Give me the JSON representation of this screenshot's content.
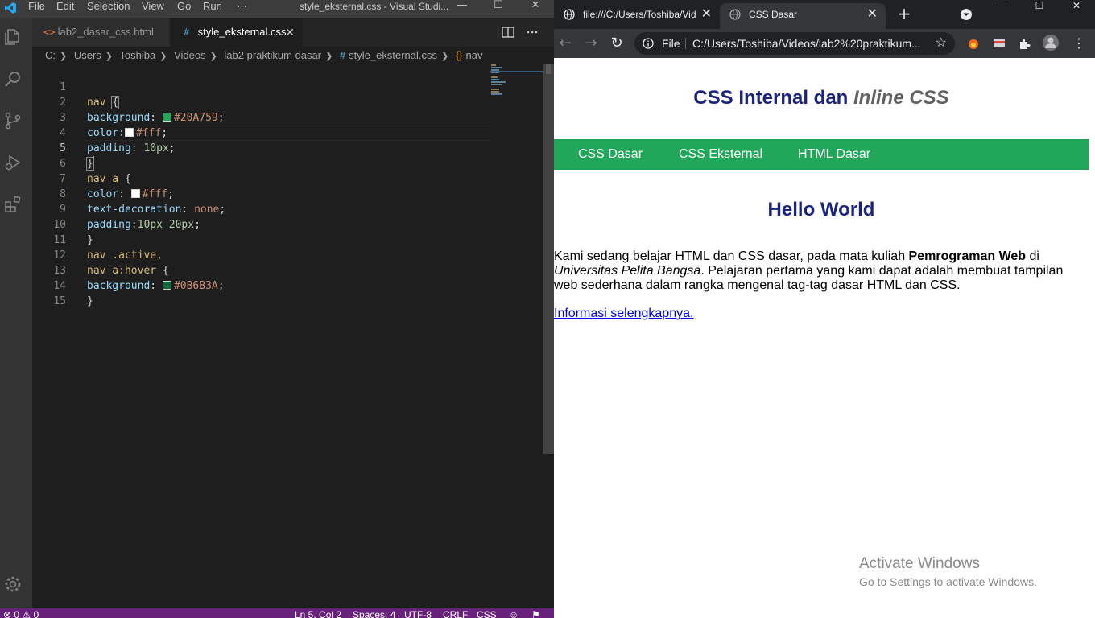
{
  "vscode": {
    "menu": [
      "File",
      "Edit",
      "Selection",
      "View",
      "Go",
      "Run",
      "···"
    ],
    "window_title": "style_eksternal.css - Visual Studi...",
    "tabs": [
      {
        "label": "lab2_dasar_css.html",
        "glyph": "<>"
      },
      {
        "label": "style_eksternal.css",
        "glyph": "#",
        "close": "✕"
      }
    ],
    "breadcrumb": [
      "C:",
      "Users",
      "Toshiba",
      "Videos",
      "lab2 praktikum dasar",
      "style_eksternal.css",
      "nav"
    ],
    "colors": {
      "nav_bg": "#20A759",
      "hover_bg": "#0B6B3A",
      "white": "#fff"
    },
    "code": {
      "line_numbers": [
        "1",
        "2",
        "3",
        "4",
        "5",
        "6",
        "7",
        "8",
        "9",
        "10",
        "11",
        "12",
        "13",
        "14",
        "15"
      ],
      "l1_sel": "nav ",
      "l1_brace": "{",
      "l2_prop": "background",
      "l2_val": "#20A759",
      "l3_prop": "color",
      "l3_val": "#fff",
      "l4_prop": "padding",
      "l4_val": "10px",
      "l5_brace": "}",
      "l6_sel": "nav a ",
      "l6_brace": "{",
      "l7_prop": "color",
      "l7_val": "#fff",
      "l8_prop": "text-decoration",
      "l8_val": "none",
      "l9_prop": "padding",
      "l9_val": "10px 20px",
      "l10_brace": "}",
      "l11_sel": "nav .active,",
      "l12_sel": "nav a:hover ",
      "l12_brace": "{",
      "l13_prop": "background",
      "l13_val": "#0B6B3A",
      "l14_brace": "}"
    },
    "status": {
      "problems": "⊗ 0 ⚠ 0",
      "position": "Ln 5, Col 2",
      "spaces": "Spaces: 4",
      "encoding": "UTF-8",
      "eol": "CRLF",
      "language": "CSS"
    }
  },
  "chrome": {
    "tabs": [
      {
        "label": "file:///C:/Users/Toshiba/Vid",
        "close": "✕"
      },
      {
        "label": "CSS Dasar",
        "close": "✕"
      }
    ],
    "new_tab": "+",
    "omnibox": {
      "scheme": "File",
      "url": "C:/Users/Toshiba/Videos/lab2%20praktikum..."
    },
    "page": {
      "title_main": "CSS Internal dan ",
      "title_em": "Inline CSS",
      "nav": [
        "CSS Dasar",
        "CSS Eksternal",
        "HTML Dasar"
      ],
      "heading": "Hello World",
      "para_1": "Kami sedang belajar HTML dan CSS dasar, pada mata kuliah ",
      "para_bold": "Pemrograman Web",
      "para_2": " di ",
      "para_italic": "Universitas Pelita Bangsa",
      "para_3": ". Pelajaran pertama yang kami dapat adalah membuat tampilan web sederhana dalam rangka mengenal tag-tag dasar HTML dan CSS.",
      "link": "Informasi selengkapnya."
    }
  },
  "watermark": {
    "line1": "Activate Windows",
    "line2": "Go to Settings to activate Windows."
  }
}
